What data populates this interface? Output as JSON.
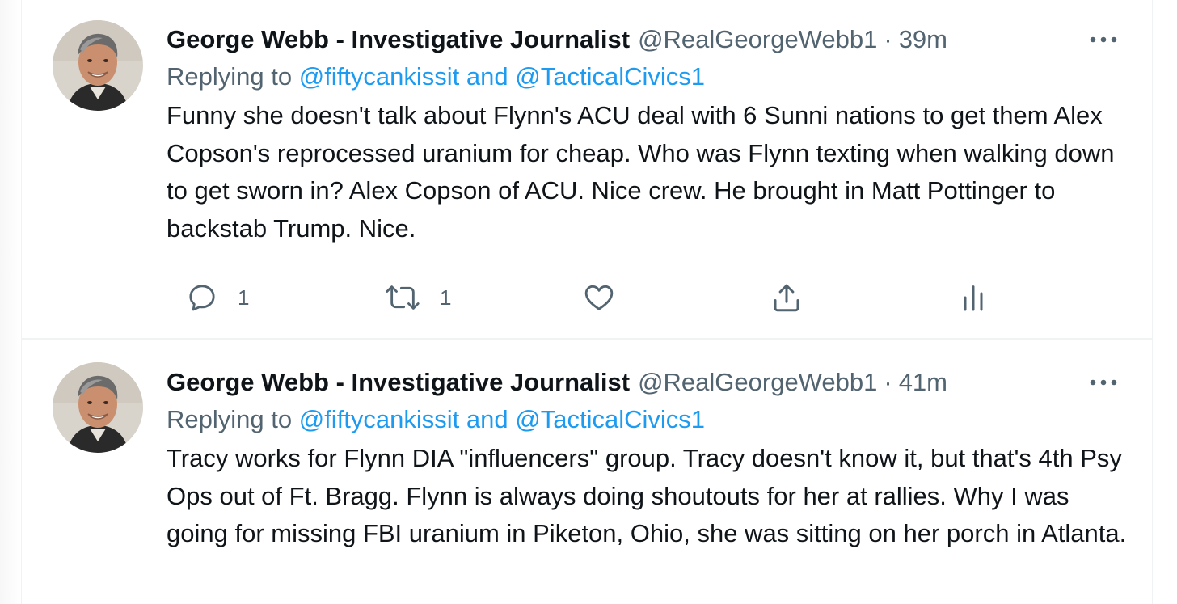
{
  "tweets": [
    {
      "display_name": "George Webb - Investigative Journalist",
      "handle": "@RealGeorgeWebb1",
      "separator": "·",
      "time": "39m",
      "replying_prefix": "Replying to",
      "reply_mention_1": "@fiftycankissit",
      "reply_and": "and",
      "reply_mention_2": "@TacticalCivics1",
      "text": "Funny she doesn't talk about Flynn's ACU deal with 6 Sunni nations to get them Alex Copson's reprocessed uranium for cheap.  Who was Flynn texting when walking down to get sworn in?  Alex Copson of ACU. Nice crew.  He brought in Matt Pottinger to backstab Trump.  Nice.",
      "actions": {
        "reply_count": "1",
        "retweet_count": "1"
      }
    },
    {
      "display_name": "George Webb - Investigative Journalist",
      "handle": "@RealGeorgeWebb1",
      "separator": "·",
      "time": "41m",
      "replying_prefix": "Replying to",
      "reply_mention_1": "@fiftycankissit",
      "reply_and": "and",
      "reply_mention_2": "@TacticalCivics1",
      "text": "Tracy works for Flynn DIA \"influencers\" group.  Tracy doesn't know it, but that's 4th Psy Ops out of Ft. Bragg. Flynn is always doing shoutouts for her at rallies. Why I was going for missing FBI uranium in Piketon, Ohio, she was sitting on her porch in Atlanta."
    }
  ],
  "icons": {
    "more": "more-dots-icon",
    "reply": "reply-bubble-icon",
    "retweet": "retweet-icon",
    "like": "heart-icon",
    "share": "share-icon",
    "analytics": "analytics-icon"
  },
  "colors": {
    "text_primary": "#0f1419",
    "text_secondary": "#536471",
    "link": "#1d9bf0",
    "divider": "#eff3f4"
  }
}
